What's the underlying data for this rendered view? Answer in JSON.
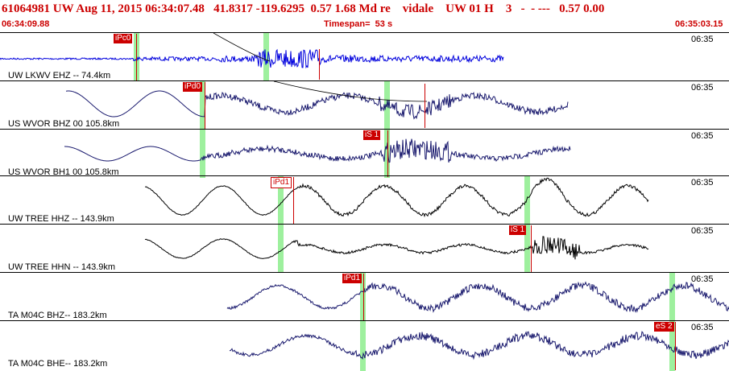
{
  "header": {
    "line1": "61064981 UW Aug 11, 2015 06:34:07.48   41.8317 -119.6295  0.57 1.68 Md re    vidale    UW 01 H    3   -  - ---   0.57 0.00"
  },
  "subheader": {
    "start_time": "06:34:09.88",
    "timespan": "Timespan=  53 s",
    "end_time": "06:35:03.15"
  },
  "colors": {
    "trace_blue": "#0000dd",
    "trace_navy": "#1a1a6e",
    "trace_black": "#000000",
    "pick_red": "#cc0000",
    "window_green": "#9ef09e"
  },
  "traces": [
    {
      "label": "UW LKWV EHZ -- 74.4km",
      "time": "06:35",
      "pick": "iPc0",
      "color": "blue"
    },
    {
      "label": "US WVOR BHZ 00 105.8km",
      "time": "06:35",
      "pick": "iPd0",
      "color": "navy"
    },
    {
      "label": "US WVOR BH1 00 105.8km",
      "time": "06:35",
      "pick": "iS 1",
      "color": "navy"
    },
    {
      "label": "UW TREE HHZ -- 143.9km",
      "time": "06:35",
      "pick": "iPd1",
      "color": "black"
    },
    {
      "label": "UW TREE HHN -- 143.9km",
      "time": "06:35",
      "pick": "iS 1",
      "color": "black"
    },
    {
      "label": "TA M04C BHZ-- 183.2km",
      "time": "06:35",
      "pick": "iPd1",
      "color": "navy"
    },
    {
      "label": "TA M04C BHE-- 183.2km",
      "time": "06:35",
      "pick": "eS 2",
      "color": "navy"
    }
  ]
}
